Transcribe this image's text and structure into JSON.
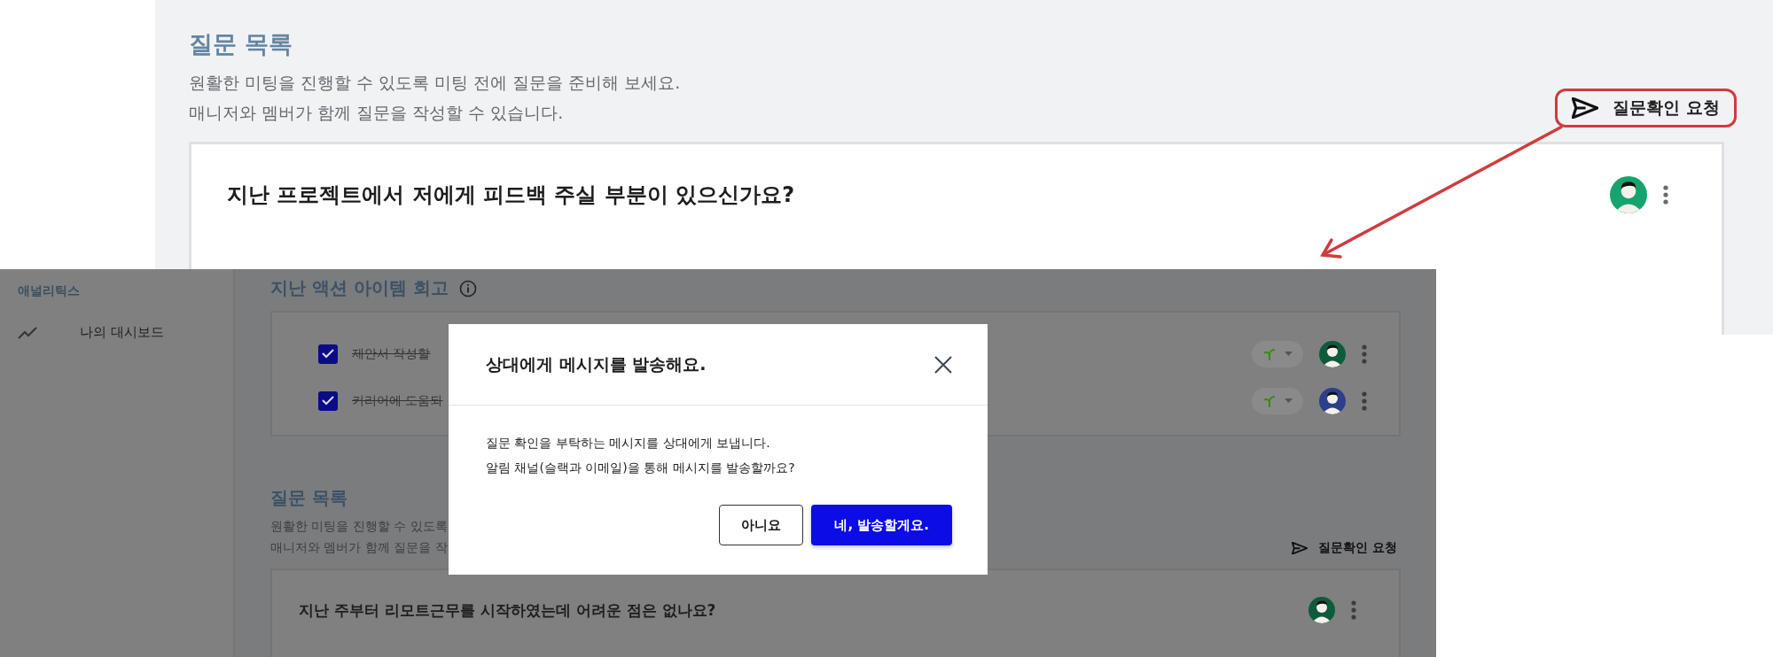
{
  "page": {
    "section_title": "질문 목록",
    "description": [
      "원활한 미팅을 진행할 수 있도록 미팅 전에 질문을 준비해 보세요.",
      "매니저와 멤버가 함께 질문을 작성할 수 있습니다."
    ],
    "request_button": {
      "label": "질문확인 요청",
      "highlighted": true
    },
    "question_card": {
      "question": "지난 프로젝트에서 저에게 피드백 주실 부분이 있으신가요?",
      "color": "#16a36e"
    }
  },
  "inset": {
    "sidebar": {
      "title": "애널리틱스",
      "items": [
        {
          "label": "나의 대시보드"
        }
      ]
    },
    "action_items": {
      "title": "지난 액션 아이템 회고",
      "items": [
        {
          "text": "제안서 작성할",
          "checked": true,
          "color": "#0e5b3b"
        },
        {
          "text": "커리어에 도움되",
          "checked": true,
          "color": "#2b3f8a"
        }
      ]
    },
    "questions": {
      "title": "질문 목록",
      "description": [
        "원활한 미팅을 진행할 수 있도록",
        "매니저와 멤버가 함께 질문을 작"
      ],
      "request_button": "질문확인 요청",
      "cards": [
        {
          "question": "지난 주부터 리모트근무를 시작하였는데 어려운 점은 없나요?",
          "color": "#0e5b3b"
        }
      ]
    },
    "dialog": {
      "title": "상대에게 메시지를 발송해요.",
      "body": [
        "질문 확인을 부탁하는 메시지를 상대에게 보냅니다.",
        "알림 채널(슬랙과 이메일)을 통해 메시지를 발송할까요?"
      ],
      "buttons": [
        {
          "label": "아니요",
          "kind": "secondary"
        },
        {
          "label": "네, 발송할게요.",
          "kind": "primary"
        }
      ]
    }
  }
}
